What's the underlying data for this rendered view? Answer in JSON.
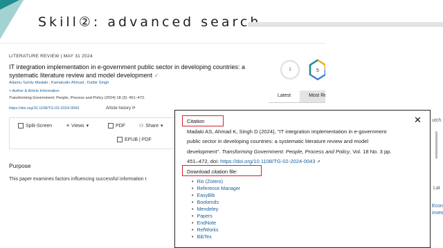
{
  "slide": {
    "title": "Skill②: advanced search"
  },
  "article": {
    "meta": "LITERATURE REVIEW | MAY 31 2024",
    "title": "IT integration implementation in e-government public sector in developing countries: a systematic literature review and model development",
    "authors": "Adamu Sa'idu Madaki ; Kamaludin Ahmad ; Dalbir Singh",
    "author_info": "+ Author & Article Information",
    "journal": "Transforming Government: People, Process and Policy (2024) 18 (3): 451–472.",
    "doi": "https://doi.org/10.1108/TG-02-2024-0043",
    "history": "Article history",
    "toolbar": {
      "split_screen": "Split-Screen",
      "views": "Views",
      "pdf": "PDF",
      "share": "Share",
      "epub": "EPUB | PDF"
    },
    "section_heading": "Purpose",
    "purpose_text": "This paper examines factors influencing successful information t"
  },
  "metrics": {
    "citations": "1",
    "altmetric": "5"
  },
  "tabs": [
    "Latest",
    "Most Re"
  ],
  "citation_dialog": {
    "title": "Citation",
    "close": "✕",
    "citation_lines": [
      "Madaki AS, Ahmad K, Singh D (2024), \"IT integration implementation in e-government",
      "public sector in developing countries: a systematic literature review and model"
    ],
    "citation_end_plain": "development\". ",
    "citation_journal": "Transforming Government: People, Process and Policy",
    "citation_vol": ", Vol. 18 No. 3 pp.",
    "citation_pages": "451–472, doi: ",
    "citation_doi": "https://doi.org/10.1108/TG-02-2024-0043",
    "download_title": "Download citation file:",
    "formats": [
      "Ris (Zotero)",
      "Reference Manager",
      "EasyBib",
      "Bookends",
      "Mendeley",
      "Papers",
      "EndNote",
      "RefWorks",
      "BibTex"
    ]
  },
  "peek": {
    "a": "utch",
    "b": "Lat",
    "c": "Econ",
    "d": "inves"
  },
  "colors": {
    "highlight_box": "#d0212c",
    "link": "#1a5e9a",
    "accent_teal": "#1f8c8f"
  }
}
